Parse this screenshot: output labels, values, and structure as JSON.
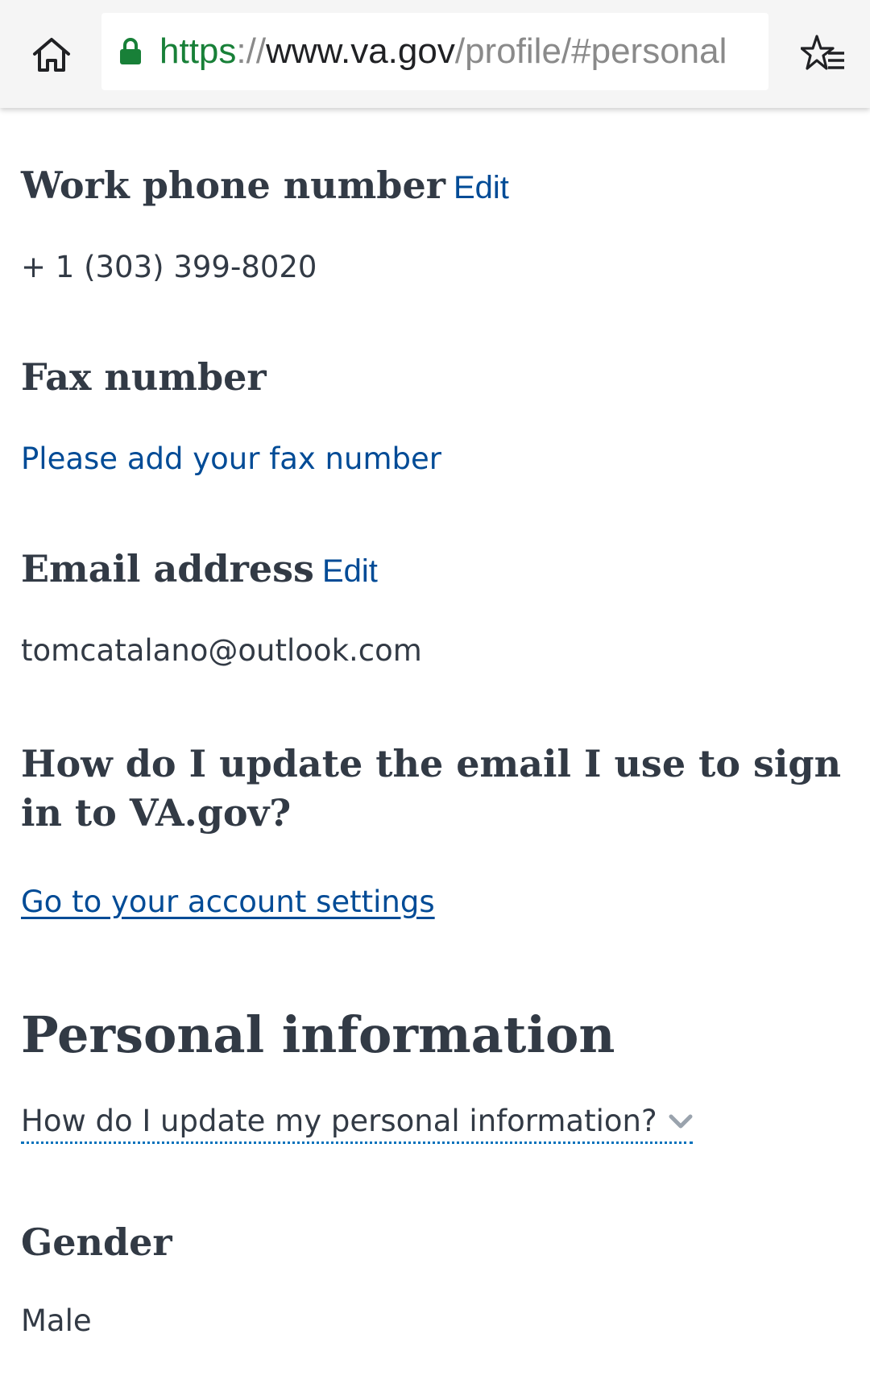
{
  "browser": {
    "url_scheme": "https",
    "url_sep": "://",
    "url_host": "www.va.gov",
    "url_path": "/profile/#personal"
  },
  "work_phone": {
    "heading": "Work phone number",
    "edit_label": "Edit",
    "value": "+ 1 (303) 399-8020"
  },
  "fax": {
    "heading": "Fax number",
    "add_link": "Please add your fax number"
  },
  "email": {
    "heading": "Email address",
    "edit_label": "Edit",
    "value": "tomcatalano@outlook.com"
  },
  "signin_email": {
    "heading": "How do I update the email I use to sign in to VA.gov?",
    "link": "Go to your account settings"
  },
  "personal_info": {
    "heading": "Personal information",
    "accordion_label": "How do I update my personal information?"
  },
  "gender": {
    "heading": "Gender",
    "value": "Male"
  }
}
